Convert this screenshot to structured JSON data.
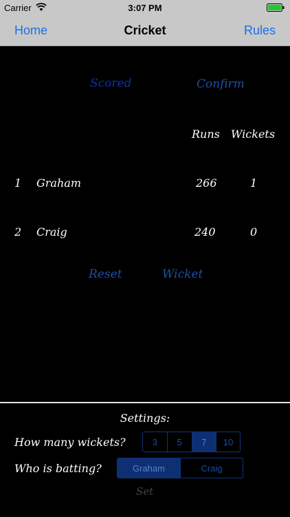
{
  "status_bar": {
    "carrier": "Carrier",
    "time": "3:07 PM"
  },
  "nav": {
    "home": "Home",
    "title": "Cricket",
    "rules": "Rules"
  },
  "actions": {
    "scored": "Scored",
    "confirm": "Confirm",
    "reset": "Reset",
    "wicket": "Wicket"
  },
  "table": {
    "headers": {
      "runs": "Runs",
      "wickets": "Wickets"
    },
    "rows": [
      {
        "rank": "1",
        "name": "Graham",
        "runs": "266",
        "wickets": "1"
      },
      {
        "rank": "2",
        "name": "Craig",
        "runs": "240",
        "wickets": "0"
      }
    ]
  },
  "settings": {
    "title": "Settings:",
    "wickets_label": "How many wickets?",
    "wicket_options": [
      "3",
      "5",
      "7",
      "10"
    ],
    "wicket_selected": "7",
    "batting_label": "Who is batting?",
    "batting_options": [
      "Graham",
      "Craig"
    ],
    "batting_selected": "Graham",
    "set_button": "Set"
  },
  "colors": {
    "accent": "#1a6fe6",
    "link": "#1f4ea8",
    "segment_selected": "#0f2f73"
  }
}
